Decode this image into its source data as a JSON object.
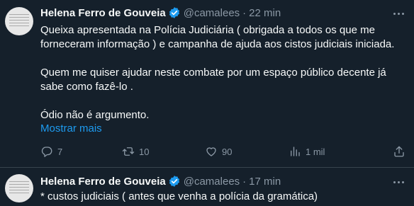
{
  "tweets": [
    {
      "author_name": "Helena Ferro de Gouveia",
      "handle": "@camalees",
      "separator": "·",
      "time": "22 min",
      "paragraphs": [
        "Queixa apresentada na Polícia Judiciária ( obrigada a todos os que me forneceram informação ) e campanha de ajuda aos cistos judiciais iniciada.",
        "Quem me quiser ajudar neste combate por um espaço público decente já sabe como fazê-lo .",
        "Ódio não é argumento."
      ],
      "show_more_label": "Mostrar mais",
      "stats": {
        "replies": "7",
        "retweets": "10",
        "likes": "90",
        "views": "1 mil"
      }
    },
    {
      "author_name": "Helena Ferro de Gouveia",
      "handle": "@camalees",
      "separator": "·",
      "time": "17 min",
      "text": "* custos judiciais ( antes que venha a polícia da gramática)"
    }
  ],
  "colors": {
    "background": "#15202b",
    "text": "#f7f9f9",
    "muted": "#8b98a5",
    "accent": "#1d9bf0",
    "divider": "#38444d"
  },
  "icons": [
    "verified-badge-icon",
    "more-icon",
    "reply-icon",
    "retweet-icon",
    "like-icon",
    "views-icon",
    "share-icon"
  ]
}
